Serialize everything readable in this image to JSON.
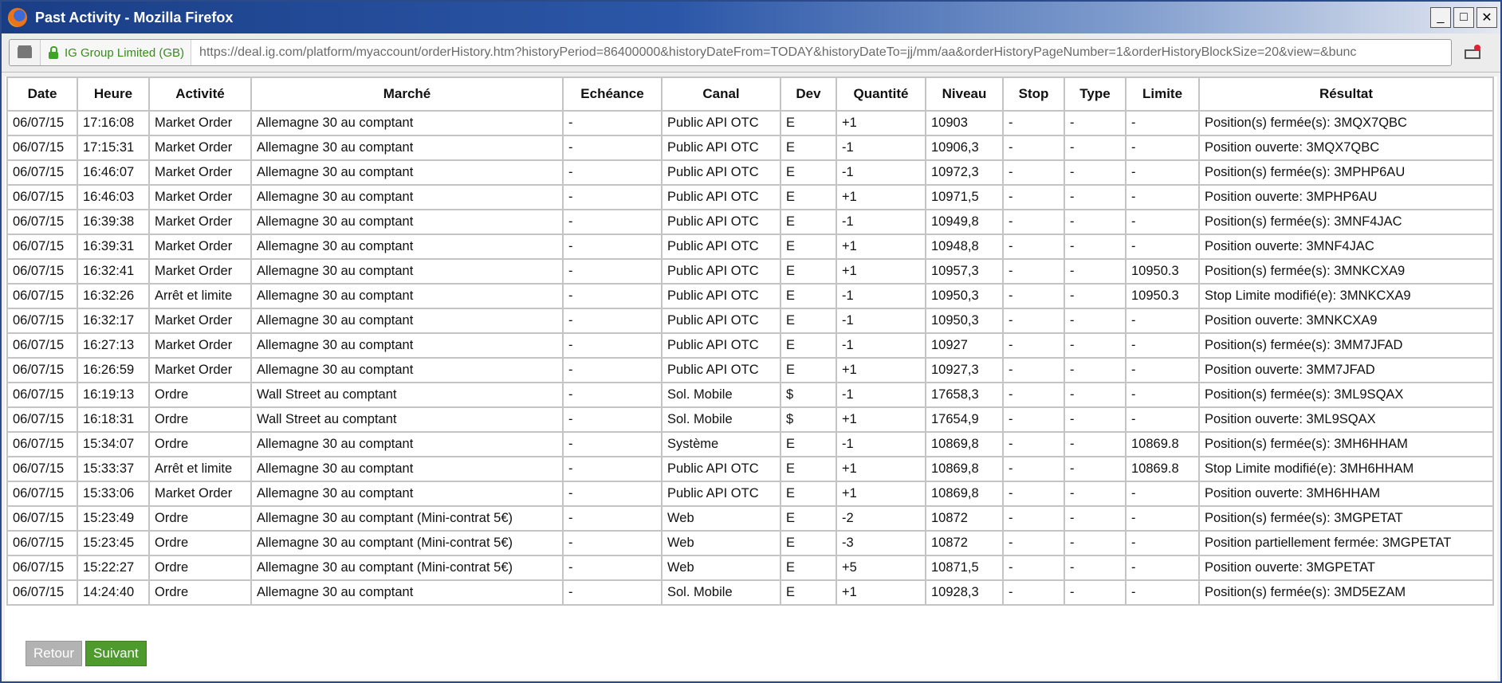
{
  "window": {
    "title": "Past Activity - Mozilla Firefox",
    "min": "_",
    "max": "□",
    "close": "✕"
  },
  "urlbar": {
    "identity": "IG Group Limited (GB)",
    "url": "https://deal.ig.com/platform/myaccount/orderHistory.htm?historyPeriod=86400000&historyDateFrom=TODAY&historyDateTo=jj/mm/aa&orderHistoryPageNumber=1&orderHistoryBlockSize=20&view=&bunc"
  },
  "table": {
    "headers": [
      "Date",
      "Heure",
      "Activité",
      "Marché",
      "Echéance",
      "Canal",
      "Dev",
      "Quantité",
      "Niveau",
      "Stop",
      "Type",
      "Limite",
      "Résultat"
    ],
    "rows": [
      [
        "06/07/15",
        "17:16:08",
        "Market Order",
        "Allemagne 30 au comptant",
        "-",
        "Public API OTC",
        "E",
        "+1",
        "10903",
        "-",
        "-",
        "-",
        "Position(s) fermée(s): 3MQX7QBC"
      ],
      [
        "06/07/15",
        "17:15:31",
        "Market Order",
        "Allemagne 30 au comptant",
        "-",
        "Public API OTC",
        "E",
        "-1",
        "10906,3",
        "-",
        "-",
        "-",
        "Position ouverte: 3MQX7QBC"
      ],
      [
        "06/07/15",
        "16:46:07",
        "Market Order",
        "Allemagne 30 au comptant",
        "-",
        "Public API OTC",
        "E",
        "-1",
        "10972,3",
        "-",
        "-",
        "-",
        "Position(s) fermée(s): 3MPHP6AU"
      ],
      [
        "06/07/15",
        "16:46:03",
        "Market Order",
        "Allemagne 30 au comptant",
        "-",
        "Public API OTC",
        "E",
        "+1",
        "10971,5",
        "-",
        "-",
        "-",
        "Position ouverte: 3MPHP6AU"
      ],
      [
        "06/07/15",
        "16:39:38",
        "Market Order",
        "Allemagne 30 au comptant",
        "-",
        "Public API OTC",
        "E",
        "-1",
        "10949,8",
        "-",
        "-",
        "-",
        "Position(s) fermée(s): 3MNF4JAC"
      ],
      [
        "06/07/15",
        "16:39:31",
        "Market Order",
        "Allemagne 30 au comptant",
        "-",
        "Public API OTC",
        "E",
        "+1",
        "10948,8",
        "-",
        "-",
        "-",
        "Position ouverte: 3MNF4JAC"
      ],
      [
        "06/07/15",
        "16:32:41",
        "Market Order",
        "Allemagne 30 au comptant",
        "-",
        "Public API OTC",
        "E",
        "+1",
        "10957,3",
        "-",
        "-",
        "10950.3",
        "Position(s) fermée(s): 3MNKCXA9"
      ],
      [
        "06/07/15",
        "16:32:26",
        "Arrêt et limite",
        "Allemagne 30 au comptant",
        "-",
        "Public API OTC",
        "E",
        "-1",
        "10950,3",
        "-",
        "-",
        "10950.3",
        "Stop Limite modifié(e): 3MNKCXA9"
      ],
      [
        "06/07/15",
        "16:32:17",
        "Market Order",
        "Allemagne 30 au comptant",
        "-",
        "Public API OTC",
        "E",
        "-1",
        "10950,3",
        "-",
        "-",
        "-",
        "Position ouverte: 3MNKCXA9"
      ],
      [
        "06/07/15",
        "16:27:13",
        "Market Order",
        "Allemagne 30 au comptant",
        "-",
        "Public API OTC",
        "E",
        "-1",
        "10927",
        "-",
        "-",
        "-",
        "Position(s) fermée(s): 3MM7JFAD"
      ],
      [
        "06/07/15",
        "16:26:59",
        "Market Order",
        "Allemagne 30 au comptant",
        "-",
        "Public API OTC",
        "E",
        "+1",
        "10927,3",
        "-",
        "-",
        "-",
        "Position ouverte: 3MM7JFAD"
      ],
      [
        "06/07/15",
        "16:19:13",
        "Ordre",
        "Wall Street au comptant",
        "-",
        "Sol. Mobile",
        "$",
        "-1",
        "17658,3",
        "-",
        "-",
        "-",
        "Position(s) fermée(s): 3ML9SQAX"
      ],
      [
        "06/07/15",
        "16:18:31",
        "Ordre",
        "Wall Street au comptant",
        "-",
        "Sol. Mobile",
        "$",
        "+1",
        "17654,9",
        "-",
        "-",
        "-",
        "Position ouverte: 3ML9SQAX"
      ],
      [
        "06/07/15",
        "15:34:07",
        "Ordre",
        "Allemagne 30 au comptant",
        "-",
        "Système",
        "E",
        "-1",
        "10869,8",
        "-",
        "-",
        "10869.8",
        "Position(s) fermée(s): 3MH6HHAM"
      ],
      [
        "06/07/15",
        "15:33:37",
        "Arrêt et limite",
        "Allemagne 30 au comptant",
        "-",
        "Public API OTC",
        "E",
        "+1",
        "10869,8",
        "-",
        "-",
        "10869.8",
        "Stop Limite modifié(e): 3MH6HHAM"
      ],
      [
        "06/07/15",
        "15:33:06",
        "Market Order",
        "Allemagne 30 au comptant",
        "-",
        "Public API OTC",
        "E",
        "+1",
        "10869,8",
        "-",
        "-",
        "-",
        "Position ouverte: 3MH6HHAM"
      ],
      [
        "06/07/15",
        "15:23:49",
        "Ordre",
        "Allemagne 30 au comptant (Mini-contrat 5€)",
        "-",
        "Web",
        "E",
        "-2",
        "10872",
        "-",
        "-",
        "-",
        "Position(s) fermée(s): 3MGPETAT"
      ],
      [
        "06/07/15",
        "15:23:45",
        "Ordre",
        "Allemagne 30 au comptant (Mini-contrat 5€)",
        "-",
        "Web",
        "E",
        "-3",
        "10872",
        "-",
        "-",
        "-",
        "Position partiellement fermée: 3MGPETAT"
      ],
      [
        "06/07/15",
        "15:22:27",
        "Ordre",
        "Allemagne 30 au comptant (Mini-contrat 5€)",
        "-",
        "Web",
        "E",
        "+5",
        "10871,5",
        "-",
        "-",
        "-",
        "Position ouverte: 3MGPETAT"
      ],
      [
        "06/07/15",
        "14:24:40",
        "Ordre",
        "Allemagne 30 au comptant",
        "-",
        "Sol. Mobile",
        "E",
        "+1",
        "10928,3",
        "-",
        "-",
        "-",
        "Position(s) fermée(s): 3MD5EZAM"
      ]
    ]
  },
  "buttons": {
    "back": "Retour",
    "next": "Suivant"
  }
}
